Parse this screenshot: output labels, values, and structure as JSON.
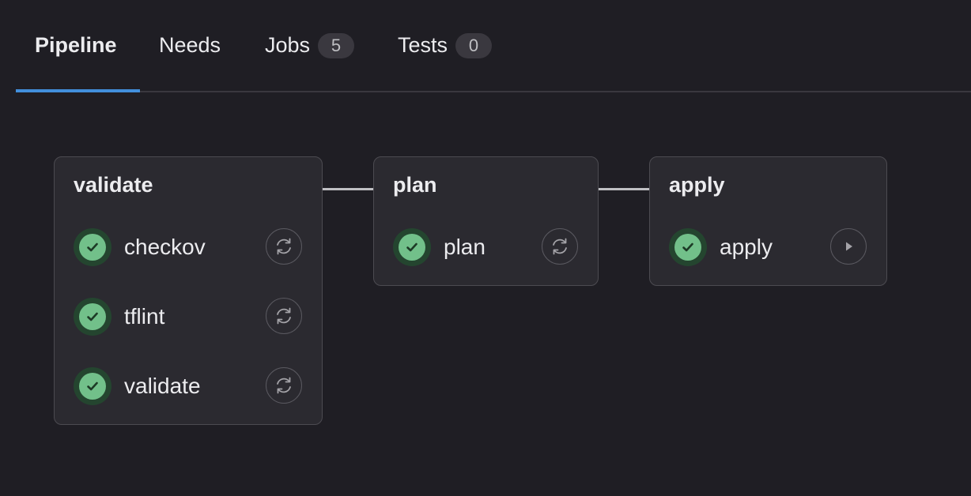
{
  "tabs": [
    {
      "label": "Pipeline",
      "active": true
    },
    {
      "label": "Needs"
    },
    {
      "label": "Jobs",
      "count": "5"
    },
    {
      "label": "Tests",
      "count": "0"
    }
  ],
  "stages": [
    {
      "title": "validate",
      "jobs": [
        {
          "name": "checkov",
          "status": "success",
          "action": "retry-icon"
        },
        {
          "name": "tflint",
          "status": "success",
          "action": "retry-icon"
        },
        {
          "name": "validate",
          "status": "success",
          "action": "retry-icon"
        }
      ]
    },
    {
      "title": "plan",
      "jobs": [
        {
          "name": "plan",
          "status": "success",
          "action": "retry-icon"
        }
      ]
    },
    {
      "title": "apply",
      "jobs": [
        {
          "name": "apply",
          "status": "success",
          "action": "play-icon"
        }
      ]
    }
  ],
  "colors": {
    "background": "#1f1e24",
    "stage_background": "#2b2a30",
    "accent": "#428fdc",
    "success": "#72c08a"
  }
}
